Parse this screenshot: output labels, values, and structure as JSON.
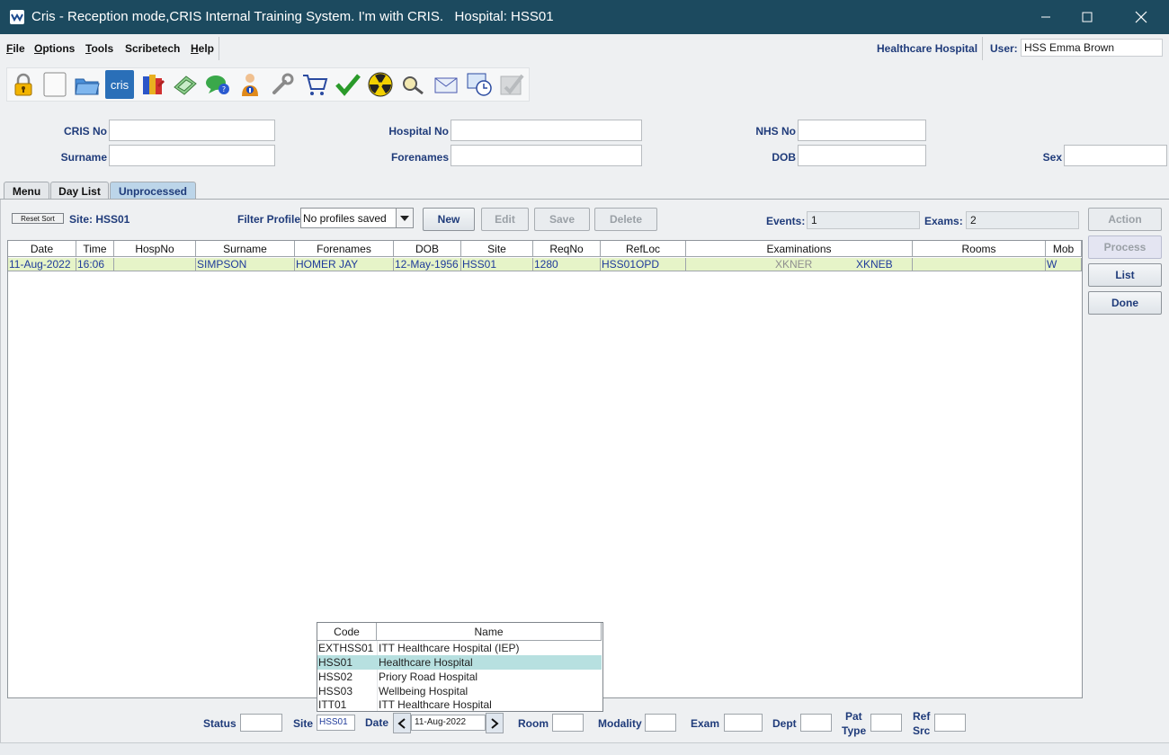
{
  "window": {
    "title": "Cris - Reception mode,CRIS Internal Training System. I'm with CRIS.   Hospital: HSS01"
  },
  "menu": {
    "items": [
      {
        "first": "F",
        "rest": "ile"
      },
      {
        "first": "O",
        "rest": "ptions"
      },
      {
        "first": "T",
        "rest": "ools"
      },
      {
        "first": "",
        "rest": "Scribetech"
      },
      {
        "first": "H",
        "rest": "elp"
      }
    ],
    "hospital": "Healthcare Hospital",
    "user_label": "User:",
    "user_value": "HSS Emma Brown"
  },
  "toolbar": {
    "icons": [
      "lock-icon",
      "blank-page-icon",
      "open-folder-icon",
      "cris-logo-icon",
      "books-icon",
      "money-icon",
      "chat-icon",
      "info-person-icon",
      "wrench-icon",
      "cart-icon",
      "checkmark-icon",
      "radiation-icon",
      "magnifier-icon",
      "mail-icon",
      "clock-window-icon",
      "disabled-check-icon"
    ],
    "cris_label": "cris"
  },
  "search": {
    "cris_no": "CRIS No",
    "hospital_no": "Hospital No",
    "nhs_no": "NHS No",
    "surname": "Surname",
    "forenames": "Forenames",
    "dob": "DOB",
    "sex": "Sex"
  },
  "tabs": [
    "Menu",
    "Day List",
    "Unprocessed"
  ],
  "list": {
    "reset_sort": "Reset Sort",
    "site_label": "Site: HSS01",
    "filter_profile_label": "Filter Profile",
    "filter_profile_value": "No profiles saved",
    "buttons": {
      "new": "New",
      "edit": "Edit",
      "save": "Save",
      "delete": "Delete"
    },
    "events_label": "Events:",
    "events_value": "1",
    "exams_label": "Exams:",
    "exams_value": "2",
    "columns": [
      "Date",
      "Time",
      "HospNo",
      "Surname",
      "Forenames",
      "DOB",
      "Site",
      "ReqNo",
      "RefLoc",
      "Examinations",
      "Rooms",
      "Mob"
    ],
    "rows": [
      {
        "date": "11-Aug-2022",
        "time": "16:06",
        "hospno": "",
        "surname": "SIMPSON",
        "forenames": "HOMER JAY",
        "dob": "12-May-1956",
        "site": "HSS01",
        "reqno": "1280",
        "refloc": "HSS01OPD",
        "exam1": "XKNER",
        "exam2": "XKNEB",
        "rooms": "",
        "mob": "W"
      }
    ]
  },
  "side_buttons": {
    "action": "Action",
    "process": "Process",
    "list": "List",
    "done": "Done"
  },
  "site_popup": {
    "headers": [
      "Code",
      "Name"
    ],
    "rows": [
      {
        "code": "EXTHSS01",
        "name": "ITT Healthcare Hospital (IEP)"
      },
      {
        "code": "HSS01",
        "name": "Healthcare Hospital"
      },
      {
        "code": "HSS02",
        "name": "Priory Road Hospital"
      },
      {
        "code": "HSS03",
        "name": "Wellbeing Hospital"
      },
      {
        "code": "ITT01",
        "name": "ITT Healthcare Hospital"
      }
    ],
    "selected_code": "HSS01"
  },
  "filters": {
    "status": "Status",
    "site": "Site",
    "site_value": "HSS01",
    "date": "Date",
    "date_value": "11-Aug-2022",
    "room": "Room",
    "modality": "Modality",
    "exam": "Exam",
    "dept": "Dept",
    "pat_type_1": "Pat",
    "pat_type_2": "Type",
    "ref_src_1": "Ref",
    "ref_src_2": "Src"
  },
  "colors": {
    "titlebar": "#1c4a5f",
    "label": "#1f3b7a",
    "row_highlight": "#e6f4c8",
    "popup_selected": "#b7e0e0",
    "active_tab": "#bcd5e9"
  }
}
